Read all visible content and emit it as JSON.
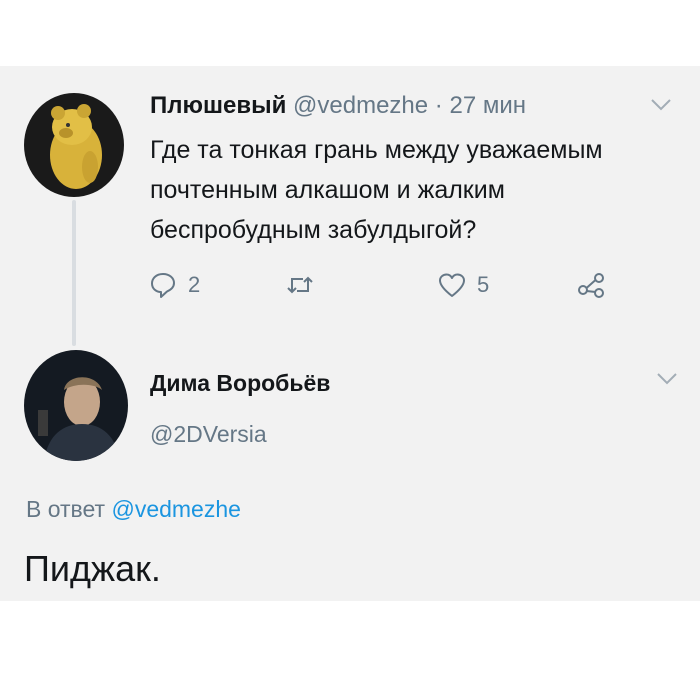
{
  "tweet": {
    "author_name": "Плюшевый",
    "author_handle": "@vedmezhe",
    "separator": "·",
    "time": "27 мин",
    "text": "Где та тонкая грань между уважаемым почтенным алкашом и жалким беспробудным забулдыгой?",
    "reply_count": "2",
    "retweet_count": "",
    "like_count": "5"
  },
  "reply": {
    "author_name": "Дима Воробьёв",
    "author_handle": "@2DVersia",
    "in_reply_to_prefix": "В ответ",
    "in_reply_to_handle": "@vedmezhe",
    "text": "Пиджак."
  },
  "icons": {
    "avatar_1": "plush-bear-avatar",
    "avatar_2": "person-avatar",
    "reply": "reply-icon",
    "retweet": "retweet-icon",
    "like": "heart-icon",
    "share": "share-icon",
    "menu": "chevron-down-icon"
  },
  "colors": {
    "background": "#f2f2f2",
    "text": "#14171a",
    "secondary_text": "#657786",
    "link": "#1b95e0",
    "thread_line": "#d9dde1"
  }
}
